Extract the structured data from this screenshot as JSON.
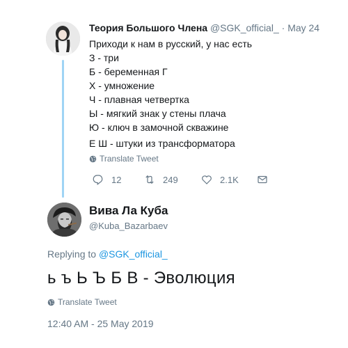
{
  "parent_tweet": {
    "display_name": "Теория Большого Члена",
    "handle": "@SGK_official_",
    "separator": "·",
    "date": "May 24",
    "lines": [
      "Приходи к нам в русский, у нас есть",
      "З - три",
      "Б - беременная Г",
      "Х - умножение",
      "Ч - плавная четвертка",
      "Ы - мягкий знак у стены плача",
      "Ю - ключ в замочной скважине",
      "Е Ш - штуки из трансформатора"
    ],
    "translate_label": "Translate Tweet",
    "actions": {
      "reply_count": "12",
      "retweet_count": "249",
      "like_count": "2.1K"
    }
  },
  "main_tweet": {
    "display_name": "Вива Ла Куба",
    "handle": "@Kuba_Bazarbaev",
    "replying_prefix": "Replying to",
    "replying_to": "@SGK_official_",
    "text": "ь ъ Ь Ъ Б В - Эволюция",
    "translate_label": "Translate Tweet",
    "timestamp": "12:40 AM - 25 May 2019"
  },
  "colors": {
    "text": "#14171a",
    "secondary": "#657786",
    "link": "#1b95e0",
    "thread_line": "#9fd4f5"
  },
  "icons": [
    "globe-icon",
    "reply-icon",
    "retweet-icon",
    "like-icon",
    "message-icon"
  ]
}
